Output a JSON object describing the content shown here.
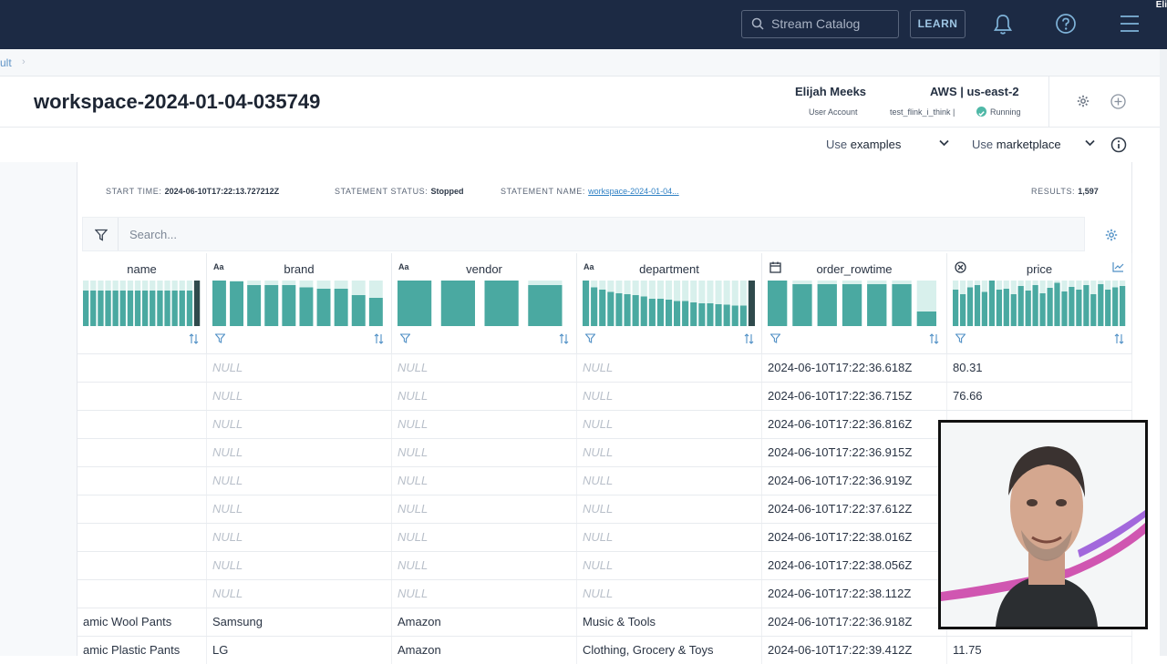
{
  "topbar": {
    "search_placeholder": "Stream Catalog",
    "learn_label": "LEARN",
    "corner_label": "Eli"
  },
  "breadcrumb": {
    "label": "ult",
    "separator": "›"
  },
  "header": {
    "workspace_title": "workspace-2024-01-04-035749",
    "user_name": "Elijah Meeks",
    "user_role": "User Account",
    "region": "AWS | us-east-2",
    "compute_pool": "test_flink_i_think |",
    "status": "Running"
  },
  "subbar": {
    "use_catalog_prefix": "Use",
    "use_catalog_value": "examples",
    "use_db_prefix": "Use",
    "use_db_value": "marketplace"
  },
  "statement": {
    "start_time_label": "START TIME:",
    "start_time_value": "2024-06-10T17:22:13.727212Z",
    "status_label": "STATEMENT STATUS:",
    "status_value": "Stopped",
    "name_label": "STATEMENT NAME:",
    "name_value": "workspace-2024-01-04...",
    "results_label": "RESULTS:",
    "results_value": "1,597"
  },
  "search": {
    "placeholder": "Search..."
  },
  "columns": [
    {
      "name": "name",
      "type_label": "",
      "hist": [
        0.78,
        0.78,
        0.78,
        0.78,
        0.78,
        0.78,
        0.78,
        0.78,
        0.78,
        0.78,
        0.78,
        0.78,
        0.78,
        0.78,
        0.78,
        1.0
      ]
    },
    {
      "name": "brand",
      "type_label": "Aa",
      "hist": [
        1.0,
        0.98,
        0.9,
        0.9,
        0.9,
        0.85,
        0.82,
        0.82,
        0.68,
        0.62
      ]
    },
    {
      "name": "vendor",
      "type_label": "Aa",
      "hist": [
        1.0,
        1.0,
        1.0,
        0.9
      ]
    },
    {
      "name": "department",
      "type_label": "Aa",
      "hist": [
        1.0,
        0.85,
        0.8,
        0.75,
        0.72,
        0.7,
        0.68,
        0.65,
        0.6,
        0.6,
        0.58,
        0.55,
        0.55,
        0.52,
        0.5,
        0.5,
        0.48,
        0.47,
        0.45,
        0.45,
        1.0
      ]
    },
    {
      "name": "order_rowtime",
      "type_label": "",
      "hist": [
        1.0,
        0.92,
        0.92,
        0.92,
        0.92,
        0.92,
        0.32
      ]
    },
    {
      "name": "price",
      "type_label": "",
      "hist": [
        0.8,
        0.7,
        0.85,
        0.9,
        0.75,
        1.0,
        0.8,
        0.82,
        0.7,
        0.88,
        0.78,
        0.9,
        0.72,
        0.84,
        0.95,
        0.76,
        0.86,
        0.8,
        0.9,
        0.7,
        0.92,
        0.8,
        0.85,
        0.88
      ]
    }
  ],
  "rows": [
    {
      "name": "",
      "brand": "NULL",
      "vendor": "NULL",
      "department": "NULL",
      "order_rowtime": "2024-06-10T17:22:36.618Z",
      "price": "80.31"
    },
    {
      "name": "",
      "brand": "NULL",
      "vendor": "NULL",
      "department": "NULL",
      "order_rowtime": "2024-06-10T17:22:36.715Z",
      "price": "76.66"
    },
    {
      "name": "",
      "brand": "NULL",
      "vendor": "NULL",
      "department": "NULL",
      "order_rowtime": "2024-06-10T17:22:36.816Z",
      "price": ""
    },
    {
      "name": "",
      "brand": "NULL",
      "vendor": "NULL",
      "department": "NULL",
      "order_rowtime": "2024-06-10T17:22:36.915Z",
      "price": ""
    },
    {
      "name": "",
      "brand": "NULL",
      "vendor": "NULL",
      "department": "NULL",
      "order_rowtime": "2024-06-10T17:22:36.919Z",
      "price": ""
    },
    {
      "name": "",
      "brand": "NULL",
      "vendor": "NULL",
      "department": "NULL",
      "order_rowtime": "2024-06-10T17:22:37.612Z",
      "price": ""
    },
    {
      "name": "",
      "brand": "NULL",
      "vendor": "NULL",
      "department": "NULL",
      "order_rowtime": "2024-06-10T17:22:38.016Z",
      "price": ""
    },
    {
      "name": "",
      "brand": "NULL",
      "vendor": "NULL",
      "department": "NULL",
      "order_rowtime": "2024-06-10T17:22:38.056Z",
      "price": ""
    },
    {
      "name": "",
      "brand": "NULL",
      "vendor": "NULL",
      "department": "NULL",
      "order_rowtime": "2024-06-10T17:22:38.112Z",
      "price": ""
    },
    {
      "name": "amic Wool Pants",
      "brand": "Samsung",
      "vendor": "Amazon",
      "department": "Music & Tools",
      "order_rowtime": "2024-06-10T17:22:36.918Z",
      "price": ""
    },
    {
      "name": "amic Plastic Pants",
      "brand": "LG",
      "vendor": "Amazon",
      "department": "Clothing, Grocery & Toys",
      "order_rowtime": "2024-06-10T17:22:39.412Z",
      "price": "11.75"
    }
  ],
  "colors": {
    "topbar_bg": "#1c2a44",
    "histogram_bar": "#4aa9a1",
    "histogram_highlight": "#2f4a4c",
    "histogram_light": "#d8f0ec",
    "running_badge": "#4fb8a7",
    "link": "#2f80c4"
  }
}
